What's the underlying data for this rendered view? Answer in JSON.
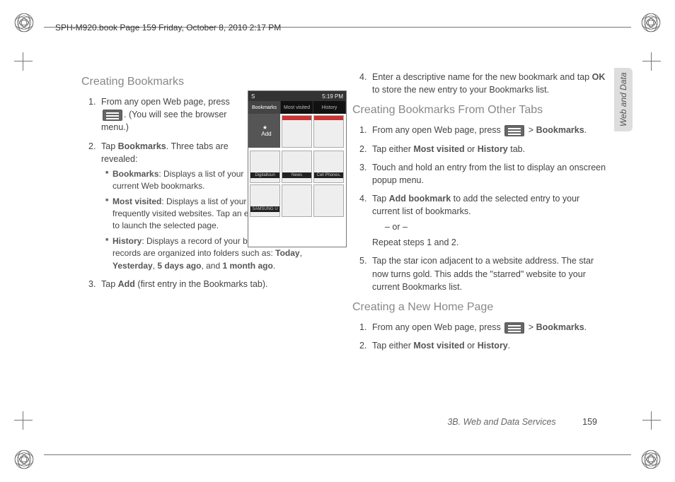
{
  "meta": {
    "header": "SPH-M920.book  Page 159  Friday, October 8, 2010  2:17 PM",
    "section_tab": "Web and Data",
    "footer_section": "3B. Web and Data Services",
    "footer_page": "159"
  },
  "left": {
    "h1": "Creating Bookmarks",
    "step1a": "From any open Web page, press ",
    "step1b": ". (You will see the browser menu.)",
    "step2a": "Tap ",
    "step2_bold": "Bookmarks",
    "step2b": ". Three tabs are revealed:",
    "sub_bm_label": "Bookmarks",
    "sub_bm_text": ": Displays a list of your current Web bookmarks.",
    "sub_mv_label": "Most visited",
    "sub_mv_text": ": Displays a list of your most frequently visited websites. Tap an entry to launch the selected page.",
    "sub_hist_label": "History",
    "sub_hist_text_a": ": Displays a record of your browsing history. These records are organized into folders such as: ",
    "hist_today": "Today",
    "hist_yest": "Yesterday",
    "hist_5d": "5 days ago",
    "hist_1m": "1 month ago",
    "step3a": "Tap ",
    "step3_bold": "Add",
    "step3b": " (first entry in the Bookmarks tab)."
  },
  "right": {
    "step4a": "Enter a descriptive name for the new bookmark and tap ",
    "step4_bold": "OK",
    "step4b": " to store the new entry to your Bookmarks list.",
    "h2": "Creating Bookmarks From Other Tabs",
    "b1a": "From any open Web page, press ",
    "b1_gt": ">",
    "b1_bold": "Bookmarks",
    "b1b": ".",
    "b2a": "Tap either ",
    "b2_mv": "Most visited",
    "b2_or": " or ",
    "b2_hist": "History",
    "b2b": " tab.",
    "b3": "Touch and hold an entry from the list to display an onscreen popup menu.",
    "b4a": "Tap ",
    "b4_bold": "Add bookmark",
    "b4b": " to add the selected entry to your current list of bookmarks.",
    "b4_or": "– or –",
    "b4_repeat": "Repeat steps 1 and 2.",
    "b5": "Tap the star icon adjacent to a website address. The star now turns gold. This adds the \"starred\" website to your current Bookmarks list.",
    "h3": "Creating a New Home Page",
    "c1a": "From any open Web page, press ",
    "c1_gt": ">",
    "c1_bold": "Bookmarks",
    "c1b": ".",
    "c2a": "Tap either ",
    "c2_mv": "Most visited",
    "c2_or": " or ",
    "c2_hist": "History",
    "c2b": "."
  },
  "phone": {
    "status_left": "S",
    "status_right": "5:19 PM",
    "tab_bm": "Bookmarks",
    "tab_mv": "Most visited",
    "tab_hist": "History",
    "add_label": "Add",
    "thumbs": [
      "",
      "",
      "",
      "Digitaltouri",
      "News",
      "Cell Phones.",
      "SAMSUNG U",
      "",
      ""
    ]
  }
}
